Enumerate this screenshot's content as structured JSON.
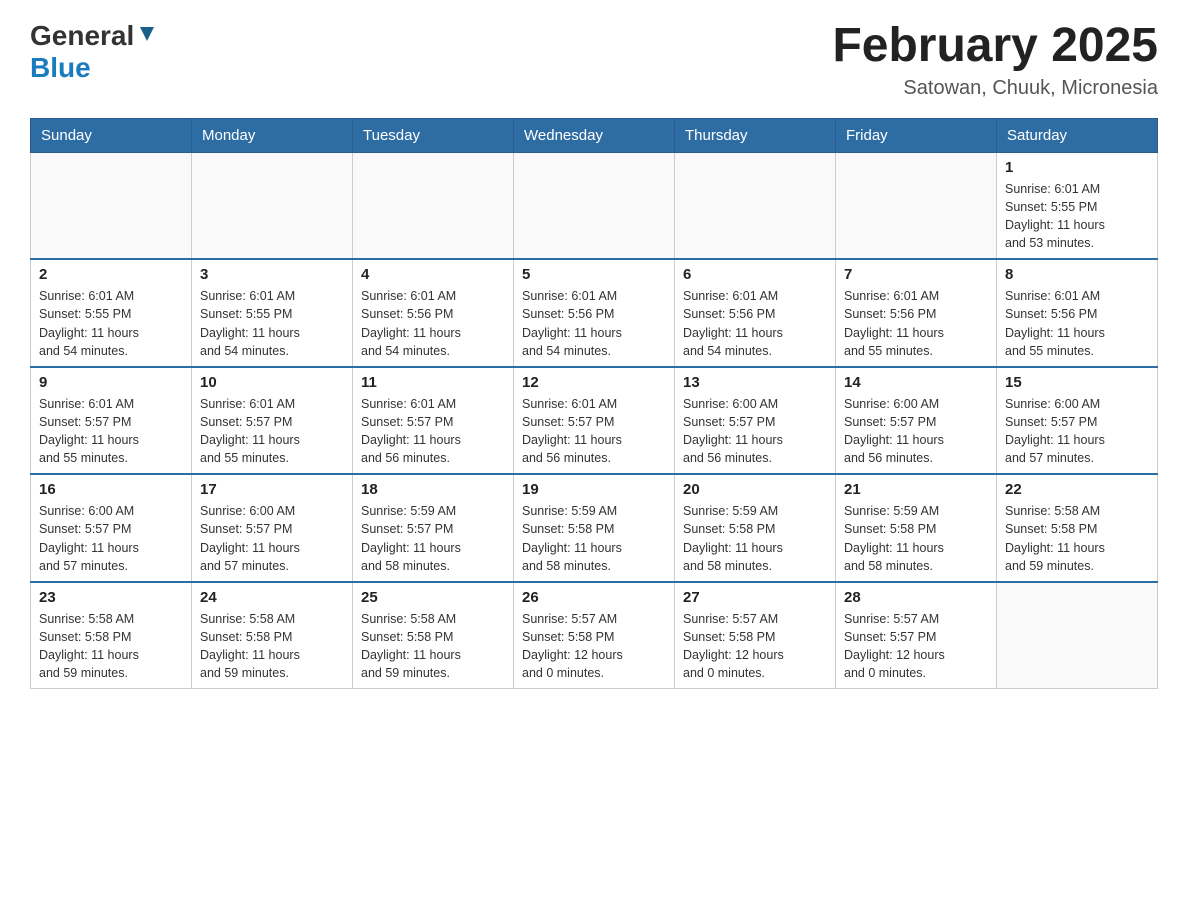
{
  "header": {
    "logo_general": "General",
    "logo_blue": "Blue",
    "title": "February 2025",
    "subtitle": "Satowan, Chuuk, Micronesia"
  },
  "days_of_week": [
    "Sunday",
    "Monday",
    "Tuesday",
    "Wednesday",
    "Thursday",
    "Friday",
    "Saturday"
  ],
  "weeks": [
    {
      "days": [
        {
          "number": "",
          "info": ""
        },
        {
          "number": "",
          "info": ""
        },
        {
          "number": "",
          "info": ""
        },
        {
          "number": "",
          "info": ""
        },
        {
          "number": "",
          "info": ""
        },
        {
          "number": "",
          "info": ""
        },
        {
          "number": "1",
          "info": "Sunrise: 6:01 AM\nSunset: 5:55 PM\nDaylight: 11 hours\nand 53 minutes."
        }
      ]
    },
    {
      "days": [
        {
          "number": "2",
          "info": "Sunrise: 6:01 AM\nSunset: 5:55 PM\nDaylight: 11 hours\nand 54 minutes."
        },
        {
          "number": "3",
          "info": "Sunrise: 6:01 AM\nSunset: 5:55 PM\nDaylight: 11 hours\nand 54 minutes."
        },
        {
          "number": "4",
          "info": "Sunrise: 6:01 AM\nSunset: 5:56 PM\nDaylight: 11 hours\nand 54 minutes."
        },
        {
          "number": "5",
          "info": "Sunrise: 6:01 AM\nSunset: 5:56 PM\nDaylight: 11 hours\nand 54 minutes."
        },
        {
          "number": "6",
          "info": "Sunrise: 6:01 AM\nSunset: 5:56 PM\nDaylight: 11 hours\nand 54 minutes."
        },
        {
          "number": "7",
          "info": "Sunrise: 6:01 AM\nSunset: 5:56 PM\nDaylight: 11 hours\nand 55 minutes."
        },
        {
          "number": "8",
          "info": "Sunrise: 6:01 AM\nSunset: 5:56 PM\nDaylight: 11 hours\nand 55 minutes."
        }
      ]
    },
    {
      "days": [
        {
          "number": "9",
          "info": "Sunrise: 6:01 AM\nSunset: 5:57 PM\nDaylight: 11 hours\nand 55 minutes."
        },
        {
          "number": "10",
          "info": "Sunrise: 6:01 AM\nSunset: 5:57 PM\nDaylight: 11 hours\nand 55 minutes."
        },
        {
          "number": "11",
          "info": "Sunrise: 6:01 AM\nSunset: 5:57 PM\nDaylight: 11 hours\nand 56 minutes."
        },
        {
          "number": "12",
          "info": "Sunrise: 6:01 AM\nSunset: 5:57 PM\nDaylight: 11 hours\nand 56 minutes."
        },
        {
          "number": "13",
          "info": "Sunrise: 6:00 AM\nSunset: 5:57 PM\nDaylight: 11 hours\nand 56 minutes."
        },
        {
          "number": "14",
          "info": "Sunrise: 6:00 AM\nSunset: 5:57 PM\nDaylight: 11 hours\nand 56 minutes."
        },
        {
          "number": "15",
          "info": "Sunrise: 6:00 AM\nSunset: 5:57 PM\nDaylight: 11 hours\nand 57 minutes."
        }
      ]
    },
    {
      "days": [
        {
          "number": "16",
          "info": "Sunrise: 6:00 AM\nSunset: 5:57 PM\nDaylight: 11 hours\nand 57 minutes."
        },
        {
          "number": "17",
          "info": "Sunrise: 6:00 AM\nSunset: 5:57 PM\nDaylight: 11 hours\nand 57 minutes."
        },
        {
          "number": "18",
          "info": "Sunrise: 5:59 AM\nSunset: 5:57 PM\nDaylight: 11 hours\nand 58 minutes."
        },
        {
          "number": "19",
          "info": "Sunrise: 5:59 AM\nSunset: 5:58 PM\nDaylight: 11 hours\nand 58 minutes."
        },
        {
          "number": "20",
          "info": "Sunrise: 5:59 AM\nSunset: 5:58 PM\nDaylight: 11 hours\nand 58 minutes."
        },
        {
          "number": "21",
          "info": "Sunrise: 5:59 AM\nSunset: 5:58 PM\nDaylight: 11 hours\nand 58 minutes."
        },
        {
          "number": "22",
          "info": "Sunrise: 5:58 AM\nSunset: 5:58 PM\nDaylight: 11 hours\nand 59 minutes."
        }
      ]
    },
    {
      "days": [
        {
          "number": "23",
          "info": "Sunrise: 5:58 AM\nSunset: 5:58 PM\nDaylight: 11 hours\nand 59 minutes."
        },
        {
          "number": "24",
          "info": "Sunrise: 5:58 AM\nSunset: 5:58 PM\nDaylight: 11 hours\nand 59 minutes."
        },
        {
          "number": "25",
          "info": "Sunrise: 5:58 AM\nSunset: 5:58 PM\nDaylight: 11 hours\nand 59 minutes."
        },
        {
          "number": "26",
          "info": "Sunrise: 5:57 AM\nSunset: 5:58 PM\nDaylight: 12 hours\nand 0 minutes."
        },
        {
          "number": "27",
          "info": "Sunrise: 5:57 AM\nSunset: 5:58 PM\nDaylight: 12 hours\nand 0 minutes."
        },
        {
          "number": "28",
          "info": "Sunrise: 5:57 AM\nSunset: 5:57 PM\nDaylight: 12 hours\nand 0 minutes."
        },
        {
          "number": "",
          "info": ""
        }
      ]
    }
  ]
}
